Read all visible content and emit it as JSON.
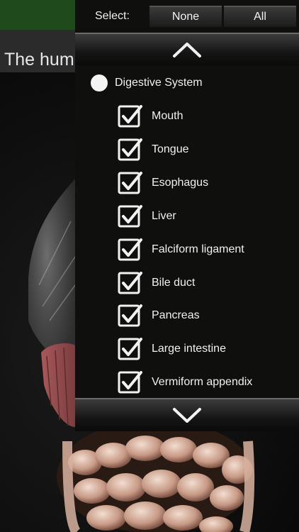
{
  "background": {
    "title": "The hum"
  },
  "select_bar": {
    "label": "Select:",
    "none_label": "None",
    "all_label": "All"
  },
  "scroll": {
    "up_icon": "chevron-up-icon",
    "down_icon": "chevron-down-icon"
  },
  "group": {
    "label": "Digestive System"
  },
  "items": [
    {
      "label": "Mouth",
      "checked": true
    },
    {
      "label": "Tongue",
      "checked": true
    },
    {
      "label": "Esophagus",
      "checked": true
    },
    {
      "label": "Liver",
      "checked": true
    },
    {
      "label": "Falciform ligament",
      "checked": true
    },
    {
      "label": "Bile duct",
      "checked": true
    },
    {
      "label": "Pancreas",
      "checked": true
    },
    {
      "label": "Large intestine",
      "checked": true
    },
    {
      "label": "Vermiform appendix",
      "checked": true
    }
  ],
  "colors": {
    "panel_bg": "#0f0f0e",
    "text": "#f1f1f1",
    "top_green": "#1f4b1c"
  }
}
